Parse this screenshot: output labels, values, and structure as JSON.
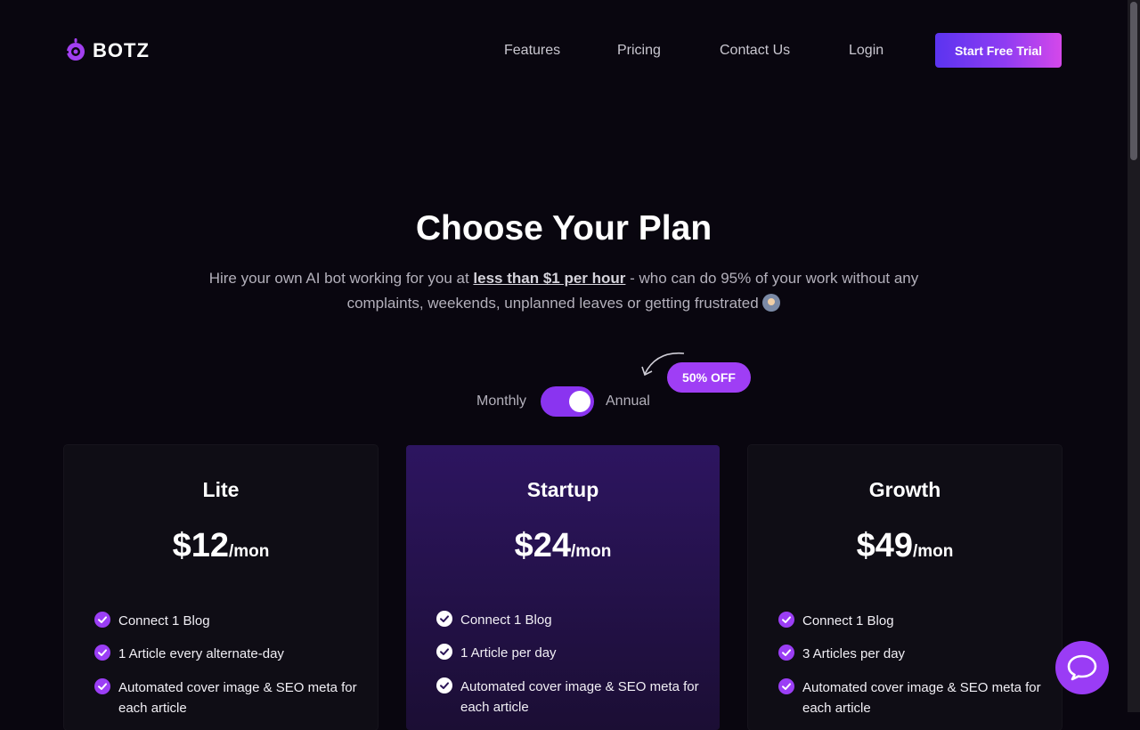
{
  "brand": {
    "name": "BOTZ",
    "accent": "#8a34f0",
    "icon": "botz-logo-icon"
  },
  "nav": {
    "items": [
      "Features",
      "Pricing",
      "Contact Us",
      "Login"
    ],
    "cta": "Start Free Trial"
  },
  "hero": {
    "title": "Choose Your Plan",
    "subtitle_pre": "Hire your own AI bot working for you at ",
    "subtitle_highlight": "less than $1 per hour",
    "subtitle_post": " - who can do 95% of your work without any complaints, weekends, unplanned leaves or getting frustrated",
    "emoji": "person-emoji"
  },
  "billing": {
    "monthly_label": "Monthly",
    "annual_label": "Annual",
    "annual_selected": true,
    "discount_badge": "50% OFF"
  },
  "plans": [
    {
      "name": "Lite",
      "price": "$12",
      "period": "/mon",
      "features": [
        "Connect 1 Blog",
        "1 Article every alternate-day",
        "Automated cover image & SEO meta for each article"
      ]
    },
    {
      "name": "Startup",
      "price": "$24",
      "period": "/mon",
      "featured": true,
      "features": [
        "Connect 1 Blog",
        "1 Article per day",
        "Automated cover image & SEO meta for each article"
      ]
    },
    {
      "name": "Growth",
      "price": "$49",
      "period": "/mon",
      "features": [
        "Connect 1 Blog",
        "3 Articles per day",
        "Automated cover image & SEO meta for each article"
      ]
    }
  ],
  "chat": {
    "icon": "chat-bubble-icon"
  }
}
